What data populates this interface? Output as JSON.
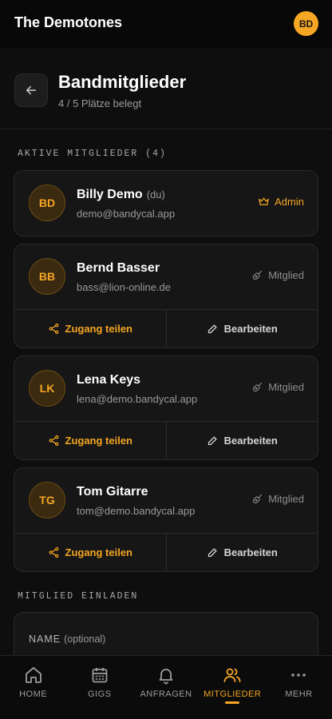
{
  "app": {
    "title": "The Demotones",
    "user_initials": "BD"
  },
  "page": {
    "title": "Bandmitglieder",
    "subtitle": "4 / 5 Plätze belegt"
  },
  "sections": {
    "active": "AKTIVE MITGLIEDER (4)",
    "invite": "MITGLIED EINLADEN"
  },
  "members": [
    {
      "initials": "BD",
      "name": "Billy Demo",
      "self_tag": "(du)",
      "email": "demo@bandycal.app",
      "role": "Admin"
    },
    {
      "initials": "BB",
      "name": "Bernd Basser",
      "email": "bass@lion-online.de",
      "role": "Mitglied",
      "share_label": "Zugang teilen",
      "edit_label": "Bearbeiten"
    },
    {
      "initials": "LK",
      "name": "Lena Keys",
      "email": "lena@demo.bandycal.app",
      "role": "Mitglied",
      "share_label": "Zugang teilen",
      "edit_label": "Bearbeiten"
    },
    {
      "initials": "TG",
      "name": "Tom Gitarre",
      "email": "tom@demo.bandycal.app",
      "role": "Mitglied",
      "share_label": "Zugang teilen",
      "edit_label": "Bearbeiten"
    }
  ],
  "invite": {
    "name_label": "NAME",
    "name_hint": "(optional)"
  },
  "nav": [
    {
      "label": "HOME",
      "icon": "home-icon"
    },
    {
      "label": "GIGS",
      "icon": "calendar-icon"
    },
    {
      "label": "ANFRAGEN",
      "icon": "bell-icon"
    },
    {
      "label": "MITGLIEDER",
      "icon": "users-icon",
      "active": true
    },
    {
      "label": "MEHR",
      "icon": "more-icon"
    }
  ],
  "colors": {
    "accent": "#f5a623",
    "background": "#0e0e0e",
    "card": "#161616"
  }
}
